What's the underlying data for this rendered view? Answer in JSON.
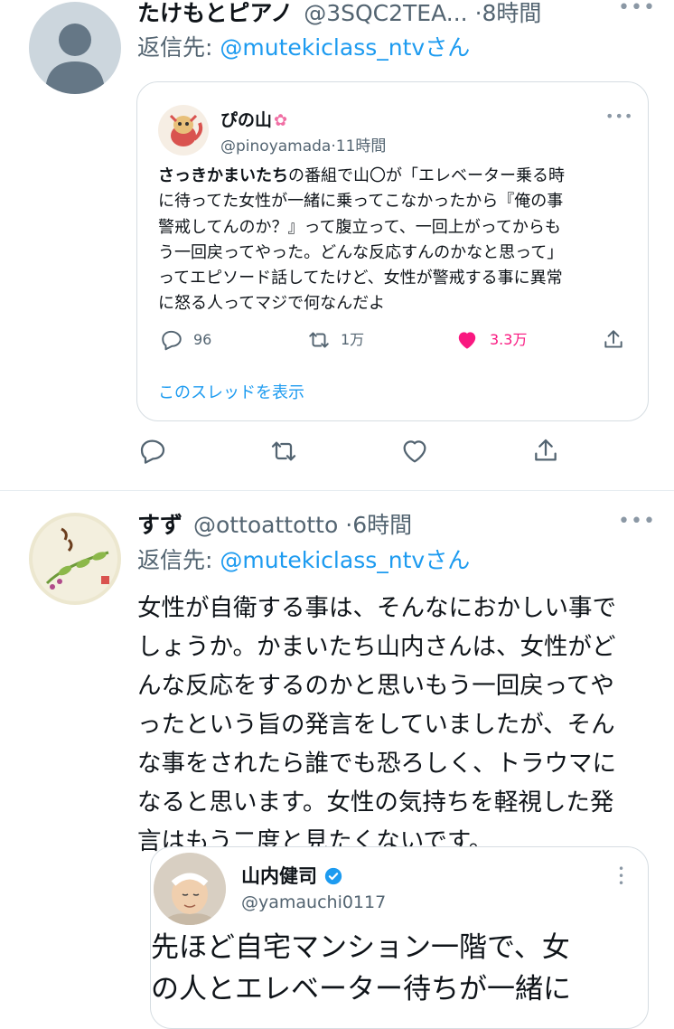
{
  "tweet1": {
    "display_name": "たけもとピアノ",
    "handle": "@3SQC2TEA...",
    "time": "8時間",
    "reply_prefix": "返信先: ",
    "reply_handle": "@mutekiclass_ntv",
    "reply_suffix": "さん",
    "quote": {
      "display_name": "ぴの山",
      "handle": "@pinoyamada",
      "time": "11時間",
      "text_bold": "さっきかまいたち",
      "text_lines": [
        "の番組で山〇が「エレベーター乗る時",
        "に待ってた女性が一緒に乗ってこなかったから『俺の事",
        "警戒してんのか？』って腹立って、一回上がってからも",
        "う一回戻ってやった。どんな反応すんのかなと思って」",
        "ってエピソード話してたけど、女性が警戒する事に異常",
        "に怒る人ってマジで何なんだよ"
      ],
      "reply_count": "96",
      "retweet_count": "1万",
      "like_count": "3.3万",
      "thread_link": "このスレッドを表示"
    }
  },
  "tweet2": {
    "display_name": "すず",
    "handle": "@ottoattotto",
    "time": "6時間",
    "reply_prefix": "返信先: ",
    "reply_handle": "@mutekiclass_ntv",
    "reply_suffix": "さん",
    "text_lines": [
      "女性が自衛する事は、そんなにおかしい事で",
      "しょうか。かまいたち山内さんは、女性がど",
      "んな反応をするのかと思いもう一回戻ってや",
      "ったという旨の発言をしていましたが、そん",
      "な事をされたら誰でも恐ろしく、トラウマに",
      "なると思います。女性の気持ちを軽視した発",
      "言はもう二度と見たくないです。"
    ],
    "quote": {
      "display_name": "山内健司",
      "handle": "@yamauchi0117",
      "text_line1": "先ほど自宅マンション一階で、女",
      "text_line2": "の人とエレベーター待ちが一緒に"
    }
  },
  "colors": {
    "accent": "#1d9bf0",
    "like": "#f91880",
    "muted": "#536471",
    "border": "#cfd9de"
  }
}
